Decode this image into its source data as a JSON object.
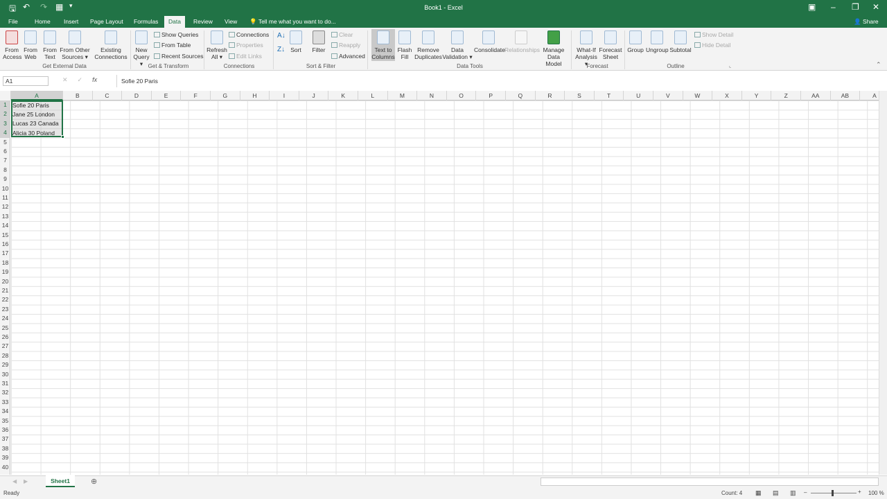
{
  "title": "Book1 - Excel",
  "qat": {
    "save": "🖫",
    "undo": "↶",
    "redo": "↷",
    "form": "▦",
    "more": "▾"
  },
  "window": {
    "restore_ribbon": "▣",
    "minimize": "–",
    "maximize": "❐",
    "close": "✕"
  },
  "tabs": [
    "File",
    "Home",
    "Insert",
    "Page Layout",
    "Formulas",
    "Data",
    "Review",
    "View"
  ],
  "active_tab": "Data",
  "tellme": "Tell me what you want to do...",
  "share": "Share",
  "ribbon": {
    "get_external": {
      "label": "Get External Data",
      "items": [
        "From Access",
        "From Web",
        "From Text",
        "From Other Sources ▾",
        "Existing Connections"
      ]
    },
    "get_transform": {
      "label": "Get & Transform",
      "new_query": "New Query ▾",
      "show_queries": "Show Queries",
      "from_table": "From Table",
      "recent_sources": "Recent Sources"
    },
    "connections": {
      "label": "Connections",
      "refresh": "Refresh All ▾",
      "connections": "Connections",
      "properties": "Properties",
      "edit_links": "Edit Links"
    },
    "sort_filter": {
      "label": "Sort & Filter",
      "sort": "Sort",
      "filter": "Filter",
      "clear": "Clear",
      "reapply": "Reapply",
      "advanced": "Advanced"
    },
    "data_tools": {
      "label": "Data Tools",
      "text_to_columns": "Text to Columns",
      "flash_fill": "Flash Fill",
      "remove_dup": "Remove Duplicates",
      "validation": "Data Validation ▾",
      "consolidate": "Consolidate",
      "relationships": "Relationships",
      "manage_model": "Manage Data Model"
    },
    "forecast": {
      "label": "Forecast",
      "what_if": "What-If Analysis ▾",
      "forecast_sheet": "Forecast Sheet"
    },
    "outline": {
      "label": "Outline",
      "group": "Group",
      "ungroup": "Ungroup",
      "subtotal": "Subtotal",
      "show_detail": "Show Detail",
      "hide_detail": "Hide Detail"
    }
  },
  "namebox": "A1",
  "formula": "Sofie 20 Paris",
  "columns": [
    "A",
    "B",
    "C",
    "D",
    "E",
    "F",
    "G",
    "H",
    "I",
    "J",
    "K",
    "L",
    "M",
    "N",
    "O",
    "P",
    "Q",
    "R",
    "S",
    "T",
    "U",
    "V",
    "W",
    "X",
    "Y",
    "Z",
    "AA",
    "AB",
    "A"
  ],
  "rows": [
    "1",
    "2",
    "3",
    "4",
    "5",
    "6",
    "7",
    "8",
    "9",
    "10",
    "11",
    "12",
    "13",
    "14",
    "15",
    "16",
    "17",
    "18",
    "19",
    "20",
    "21",
    "22",
    "23",
    "24",
    "25",
    "26",
    "27",
    "28",
    "29",
    "30",
    "31",
    "32",
    "33",
    "34",
    "35",
    "36",
    "37",
    "38",
    "39",
    "40"
  ],
  "cells": [
    "Sofie 20 Paris",
    "Jane 25 London",
    "Lucas 23 Canada",
    "Alicia 30 Poland"
  ],
  "sheet": "Sheet1",
  "status": {
    "ready": "Ready",
    "count": "Count: 4",
    "zoom": "100 %"
  }
}
